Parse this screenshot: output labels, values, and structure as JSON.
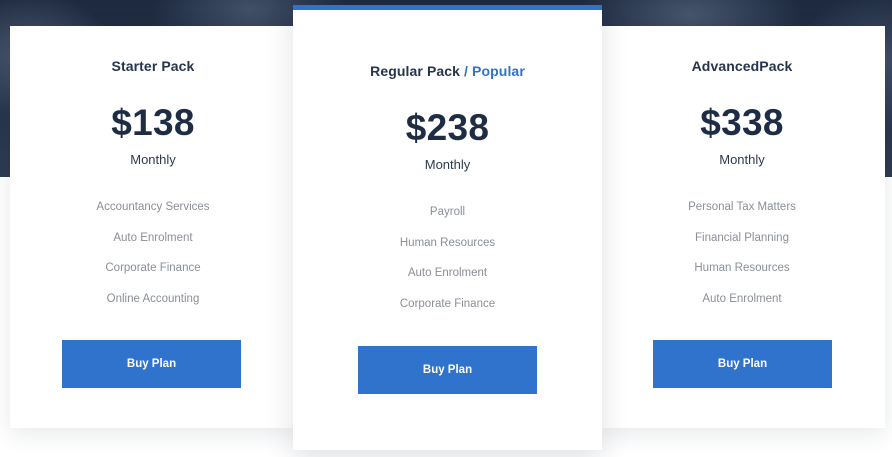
{
  "plans": [
    {
      "title": "Starter Pack",
      "price": "$138",
      "period": "Monthly",
      "features": [
        "Accountancy Services",
        "Auto Enrolment",
        "Corporate Finance",
        "Online Accounting"
      ],
      "button_label": "Buy Plan"
    },
    {
      "title": "Regular Pack",
      "slash": "/",
      "badge": "Popular",
      "price": "$238",
      "period": "Monthly",
      "features": [
        "Payroll",
        "Human Resources",
        "Auto Enrolment",
        "Corporate Finance"
      ],
      "button_label": "Buy Plan"
    },
    {
      "title": "AdvancedPack",
      "price": "$338",
      "period": "Monthly",
      "features": [
        "Personal Tax Matters",
        "Financial Planning",
        "Human Resources",
        "Auto Enrolment"
      ],
      "button_label": "Buy Plan"
    }
  ],
  "colors": {
    "accent": "#2f73cc",
    "heading": "#26354d",
    "muted_text": "#8a8f98",
    "hero_background": "#27344b"
  }
}
